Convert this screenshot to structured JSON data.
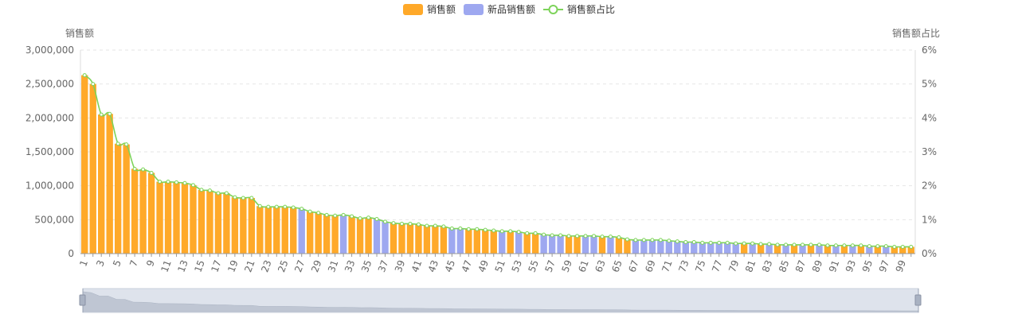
{
  "legend": {
    "sales": "销售额",
    "new_sales": "新品销售额",
    "ratio": "销售额占比"
  },
  "colors": {
    "sales": "#FFA929",
    "new_sales": "#9EA8F0",
    "line": "#7DD35A",
    "grid": "#E6E6E6",
    "zoom_bg": "#DEE3EC",
    "zoom_border": "#9AA3B4",
    "zoom_area": "#BFC6D3"
  },
  "chart_data": {
    "type": "bar",
    "title": "",
    "ylabel": "销售额",
    "y2label": "销售额占比",
    "ylim": [
      0,
      3000000
    ],
    "y2lim": [
      0,
      6
    ],
    "ytick_labels": [
      "0",
      "500,000",
      "1,000,000",
      "1,500,000",
      "2,000,000",
      "2,500,000",
      "3,000,000"
    ],
    "y2tick_labels": [
      "0%",
      "1%",
      "2%",
      "3%",
      "4%",
      "5%",
      "6%"
    ],
    "grid": true,
    "legend_position": "top-center",
    "categories": [
      "1",
      "2",
      "3",
      "4",
      "5",
      "6",
      "7",
      "8",
      "9",
      "10",
      "11",
      "12",
      "13",
      "14",
      "15",
      "16",
      "17",
      "18",
      "19",
      "20",
      "21",
      "22",
      "23",
      "24",
      "25",
      "26",
      "27",
      "28",
      "29",
      "30",
      "31",
      "32",
      "33",
      "34",
      "35",
      "36",
      "37",
      "38",
      "39",
      "40",
      "41",
      "42",
      "43",
      "44",
      "45",
      "46",
      "47",
      "48",
      "49",
      "50",
      "51",
      "52",
      "53",
      "54",
      "55",
      "56",
      "57",
      "58",
      "59",
      "60",
      "61",
      "62",
      "63",
      "64",
      "65",
      "66",
      "67",
      "68",
      "69",
      "70",
      "71",
      "72",
      "73",
      "74",
      "75",
      "76",
      "77",
      "78",
      "79",
      "80",
      "81",
      "82",
      "83",
      "84",
      "85",
      "86",
      "87",
      "88",
      "89",
      "90",
      "91",
      "92",
      "93",
      "94",
      "95",
      "96",
      "97",
      "98",
      "99",
      "100"
    ],
    "values": [
      2630000,
      2500000,
      2050000,
      2060000,
      1620000,
      1610000,
      1250000,
      1240000,
      1190000,
      1060000,
      1060000,
      1050000,
      1040000,
      1010000,
      940000,
      930000,
      890000,
      890000,
      830000,
      820000,
      820000,
      700000,
      690000,
      690000,
      690000,
      680000,
      660000,
      620000,
      600000,
      570000,
      560000,
      570000,
      550000,
      520000,
      530000,
      510000,
      470000,
      450000,
      440000,
      440000,
      430000,
      410000,
      410000,
      400000,
      370000,
      370000,
      360000,
      360000,
      350000,
      340000,
      330000,
      330000,
      320000,
      300000,
      300000,
      280000,
      270000,
      270000,
      260000,
      260000,
      260000,
      260000,
      250000,
      250000,
      240000,
      210000,
      200000,
      200000,
      200000,
      200000,
      190000,
      180000,
      170000,
      170000,
      160000,
      160000,
      160000,
      160000,
      150000,
      150000,
      150000,
      140000,
      140000,
      130000,
      130000,
      130000,
      130000,
      130000,
      130000,
      120000,
      120000,
      120000,
      120000,
      120000,
      110000,
      110000,
      110000,
      100000,
      100000,
      100000
    ],
    "new_product_indices": [
      26,
      31,
      35,
      36,
      44,
      45,
      50,
      52,
      55,
      56,
      57,
      60,
      61,
      63,
      66,
      67,
      68,
      69,
      70,
      71,
      72,
      73,
      74,
      75,
      76,
      77,
      78,
      80,
      82,
      84,
      86,
      88,
      90,
      92,
      94,
      96
    ],
    "ratio_percent": [
      5.26,
      5.0,
      4.1,
      4.12,
      3.24,
      3.22,
      2.5,
      2.48,
      2.38,
      2.12,
      2.12,
      2.1,
      2.08,
      2.02,
      1.88,
      1.86,
      1.78,
      1.78,
      1.66,
      1.64,
      1.64,
      1.4,
      1.38,
      1.38,
      1.38,
      1.36,
      1.32,
      1.24,
      1.2,
      1.14,
      1.12,
      1.14,
      1.1,
      1.04,
      1.06,
      1.02,
      0.94,
      0.9,
      0.88,
      0.88,
      0.86,
      0.82,
      0.82,
      0.8,
      0.74,
      0.74,
      0.72,
      0.72,
      0.7,
      0.68,
      0.66,
      0.66,
      0.64,
      0.6,
      0.6,
      0.56,
      0.54,
      0.54,
      0.52,
      0.52,
      0.52,
      0.52,
      0.5,
      0.5,
      0.48,
      0.42,
      0.4,
      0.4,
      0.4,
      0.4,
      0.38,
      0.36,
      0.34,
      0.34,
      0.32,
      0.32,
      0.32,
      0.32,
      0.3,
      0.3,
      0.3,
      0.28,
      0.28,
      0.26,
      0.26,
      0.26,
      0.26,
      0.26,
      0.26,
      0.24,
      0.24,
      0.24,
      0.24,
      0.24,
      0.22,
      0.22,
      0.22,
      0.2,
      0.2,
      0.2
    ]
  }
}
